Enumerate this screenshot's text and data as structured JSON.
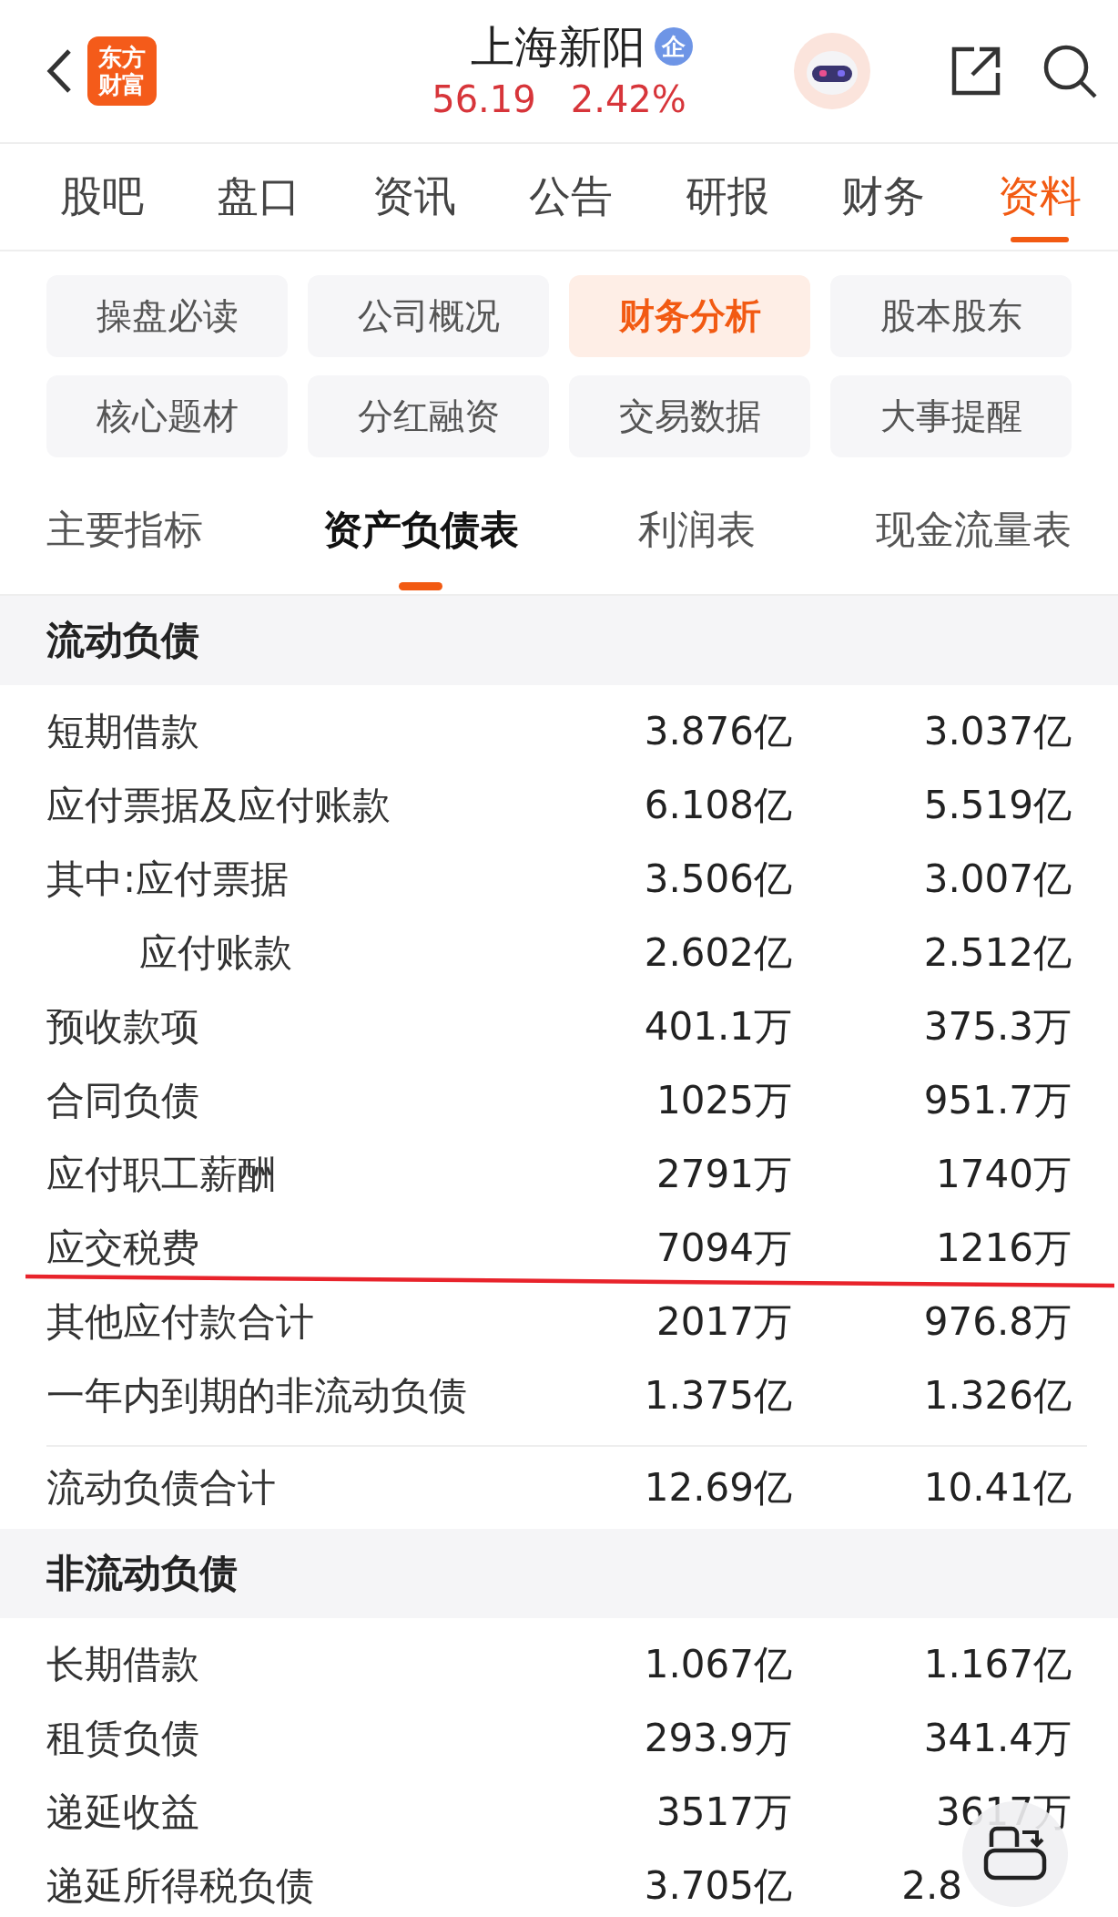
{
  "header": {
    "logo": [
      "东方",
      "财富"
    ],
    "title": "上海新阳",
    "badge": "企",
    "price": "56.19",
    "change": "2.42%"
  },
  "tabs": [
    {
      "label": "股吧",
      "selected": false
    },
    {
      "label": "盘口",
      "selected": false
    },
    {
      "label": "资讯",
      "selected": false
    },
    {
      "label": "公告",
      "selected": false
    },
    {
      "label": "研报",
      "selected": false
    },
    {
      "label": "财务",
      "selected": false
    },
    {
      "label": "资料",
      "selected": true
    }
  ],
  "categories": [
    {
      "label": "操盘必读",
      "selected": false
    },
    {
      "label": "公司概况",
      "selected": false
    },
    {
      "label": "财务分析",
      "selected": true
    },
    {
      "label": "股本股东",
      "selected": false
    },
    {
      "label": "核心题材",
      "selected": false
    },
    {
      "label": "分红融资",
      "selected": false
    },
    {
      "label": "交易数据",
      "selected": false
    },
    {
      "label": "大事提醒",
      "selected": false
    }
  ],
  "statements": [
    {
      "label": "主要指标",
      "selected": false
    },
    {
      "label": "资产负债表",
      "selected": true
    },
    {
      "label": "利润表",
      "selected": false
    },
    {
      "label": "现金流量表",
      "selected": false
    }
  ],
  "sections": [
    {
      "title": "流动负债",
      "rows": [
        {
          "kind": "item",
          "label": "短期借款",
          "values": [
            "3.876亿",
            "3.037亿"
          ]
        },
        {
          "kind": "item",
          "label": "应付票据及应付账款",
          "values": [
            "6.108亿",
            "5.519亿"
          ]
        },
        {
          "kind": "item",
          "label": "其中:应付票据",
          "values": [
            "3.506亿",
            "3.007亿"
          ]
        },
        {
          "kind": "sub",
          "label": "应付账款",
          "values": [
            "2.602亿",
            "2.512亿"
          ]
        },
        {
          "kind": "item",
          "label": "预收款项",
          "values": [
            "401.1万",
            "375.3万"
          ]
        },
        {
          "kind": "item",
          "label": "合同负债",
          "values": [
            "1025万",
            "951.7万"
          ]
        },
        {
          "kind": "item",
          "label": "应付职工薪酬",
          "values": [
            "2791万",
            "1740万"
          ]
        },
        {
          "kind": "item",
          "label": "应交税费",
          "values": [
            "7094万",
            "1216万"
          ]
        },
        {
          "kind": "item",
          "label": "其他应付款合计",
          "values": [
            "2017万",
            "976.8万"
          ]
        },
        {
          "kind": "item",
          "label": "一年内到期的非流动负债",
          "values": [
            "1.375亿",
            "1.326亿"
          ]
        }
      ],
      "total": {
        "label": "流动负债合计",
        "values": [
          "12.69亿",
          "10.41亿"
        ]
      }
    },
    {
      "title": "非流动负债",
      "rows": [
        {
          "kind": "item",
          "label": "长期借款",
          "values": [
            "1.067亿",
            "1.167亿"
          ]
        },
        {
          "kind": "item",
          "label": "租赁负债",
          "values": [
            "293.9万",
            "341.4万"
          ]
        },
        {
          "kind": "item",
          "label": "递延收益",
          "values": [
            "3517万",
            "3617万"
          ]
        },
        {
          "kind": "item",
          "label": "递延所得税负债",
          "values": [
            "3.705亿",
            "2.8"
          ],
          "covered": true
        }
      ]
    }
  ]
}
